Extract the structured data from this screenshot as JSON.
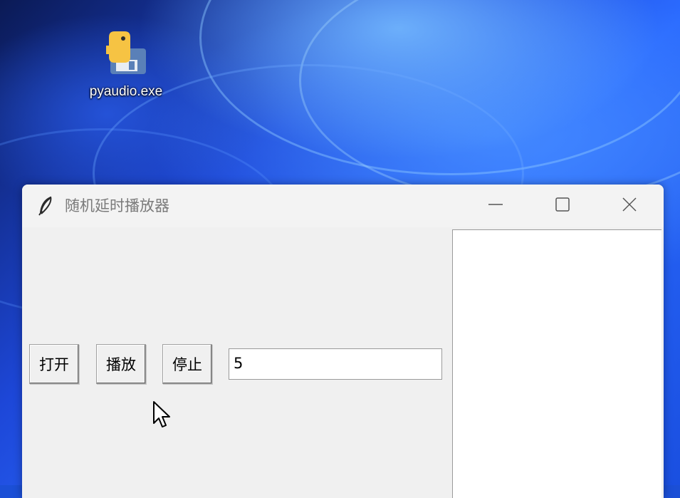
{
  "desktop": {
    "icon_label": "pyaudio.exe",
    "icon_name": "python-exe-icon"
  },
  "window": {
    "title": "随机延时播放器",
    "app_icon": "tk-feather-icon",
    "controls": {
      "minimize_icon": "minimize-icon",
      "maximize_icon": "maximize-icon",
      "close_icon": "close-icon"
    }
  },
  "toolbar": {
    "open_label": "打开",
    "play_label": "播放",
    "stop_label": "停止"
  },
  "delay_entry": {
    "value": "5"
  },
  "colors": {
    "window_bg": "#f0f0f0",
    "title_text": "#7a7a7a",
    "desktop_blue": "#1d47d8"
  }
}
